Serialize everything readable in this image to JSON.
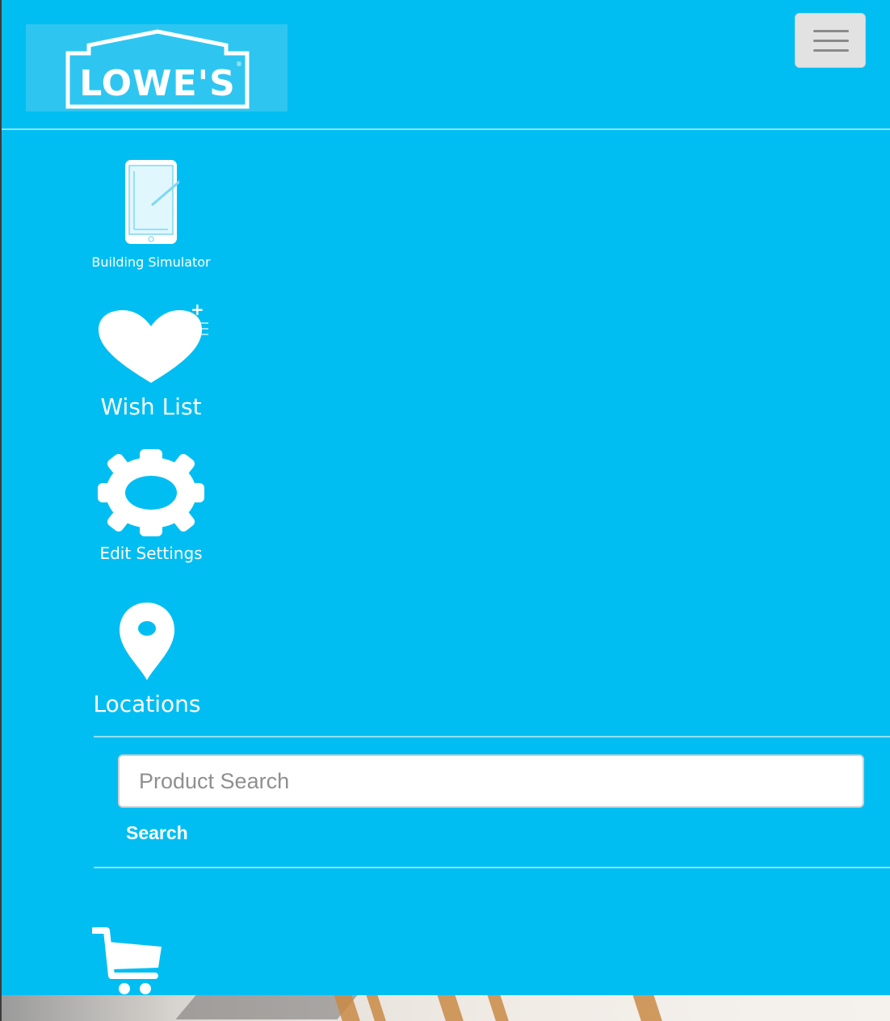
{
  "brand": {
    "logo_text": "LOWE'S",
    "logo_registered": "®",
    "panel_color": "#00bef2"
  },
  "header": {
    "menu_toggle_label": ""
  },
  "nav": {
    "items": [
      {
        "label": "Building Simulator",
        "icon": "tablet-pen-icon"
      },
      {
        "label": "Wish List",
        "icon": "heart-plus-icon"
      },
      {
        "label": "Edit Settings",
        "icon": "gear-icon"
      },
      {
        "label": "Locations",
        "icon": "map-pin-icon"
      }
    ]
  },
  "search": {
    "placeholder": "Product Search",
    "value": "",
    "button_label": "Search"
  },
  "cart": {
    "icon": "cart-icon"
  }
}
